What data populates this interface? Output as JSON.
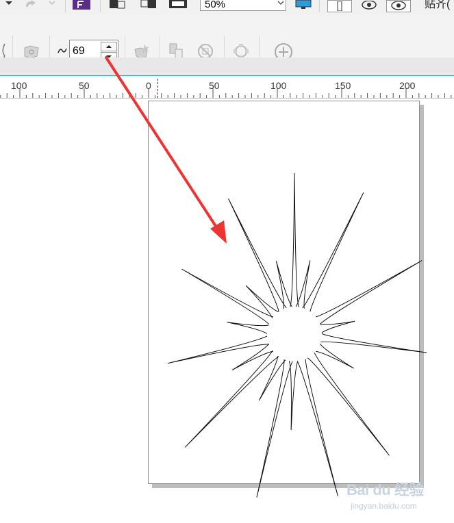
{
  "toolbar": {
    "zoom_value": "50%",
    "snap_label": "贴齐(",
    "smoothness_value": "69"
  },
  "rulers": {
    "horizontal_labels": [
      "100",
      "50",
      "0",
      "50",
      "100",
      "150",
      "200"
    ]
  },
  "watermark": {
    "brand": "Bai du 经验",
    "url": "jingyan.baidu.com"
  },
  "colors": {
    "accent_blue": "#1fa6e6",
    "arrow_red": "#ee3333",
    "purple_icon": "#5a2d86"
  }
}
